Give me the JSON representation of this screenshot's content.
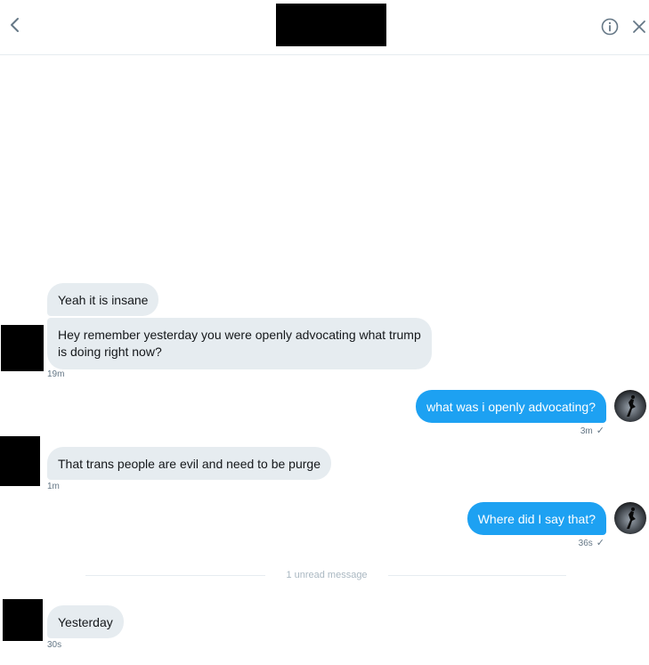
{
  "header": {
    "back_icon": "chevron-left-icon",
    "info_icon": "info-circle-icon",
    "close_icon": "close-icon"
  },
  "messages": [
    {
      "id": "m1",
      "direction": "incoming",
      "text": "Yeah it is insane"
    },
    {
      "id": "m2",
      "direction": "incoming",
      "text": "Hey remember yesterday you were openly advocating what trump is doing right now?",
      "time": "19m"
    },
    {
      "id": "m3",
      "direction": "outgoing",
      "text": "what was i openly advocating?",
      "time": "3m",
      "status": "✓"
    },
    {
      "id": "m4",
      "direction": "incoming",
      "text": "That trans people are evil and need to be purge",
      "time": "1m"
    },
    {
      "id": "m5",
      "direction": "outgoing",
      "text": "Where did I say that?",
      "time": "36s",
      "status": "✓"
    },
    {
      "id": "m6",
      "direction": "incoming",
      "text": "Yesterday",
      "time": "30s"
    }
  ],
  "unread_divider": "1 unread message",
  "colors": {
    "outgoing_bubble": "#1da1f2",
    "incoming_bubble": "#e6ecf0",
    "timestamp": "#657786"
  }
}
